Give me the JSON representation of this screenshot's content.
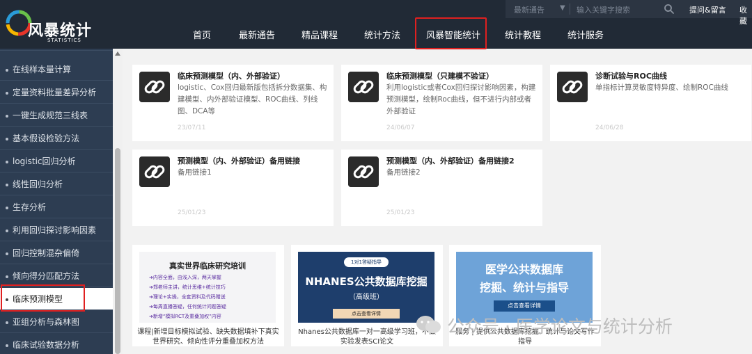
{
  "header": {
    "logo_title": "风暴统计",
    "logo_sub": "STATISTICS",
    "notice_select": "最新通告",
    "search_placeholder": "输入关键字搜索",
    "links": [
      "提问&留言",
      "收藏"
    ],
    "nav": [
      "首页",
      "最新通告",
      "精品课程",
      "统计方法",
      "风暴智能统计",
      "统计教程",
      "统计服务"
    ]
  },
  "sidebar": {
    "items": [
      "在线样本量计算",
      "定量资料批量差异分析",
      "一键生成规范三线表",
      "基本假设检验方法",
      "logistic回归分析",
      "线性回归分析",
      "生存分析",
      "利用回归探讨影响因素",
      "回归控制混杂偏倚",
      "倾向得分匹配方法",
      "临床预测模型",
      "亚组分析与森林图",
      "临床试验数据分析"
    ],
    "active": "临床预测模型"
  },
  "cards": [
    {
      "title": "临床预测模型（内、外部验证）",
      "desc": "logistic、Cox回归最新版包括拆分数据集、构建模型、内外部验证模型、ROC曲线、列线图、DCA等",
      "date": "23/07/11"
    },
    {
      "title": "临床预测模型（只建模不验证）",
      "desc": "利用logistic或者Cox回归探讨影响因素，构建预测模型，绘制Roc曲线，但不进行内部或者外部验证",
      "date": "24/06/07"
    },
    {
      "title": "诊断试验与ROC曲线",
      "desc": "单指标计算灵敏度特异度、绘制ROC曲线",
      "date": "24/06/28"
    },
    {
      "title": "预测模型（内、外部验证）备用链接",
      "desc": "备用链接1",
      "date": "25/01/23"
    },
    {
      "title": "预测模型（内、外部验证）备用链接2",
      "desc": "备用链接2",
      "date": "25/01/23"
    }
  ],
  "promos": [
    {
      "heading": "真实世界临床研究培训",
      "bullets": [
        "➜内容全面，由浅入深，两天掌握",
        "➜郑老师主讲，统计思维+统计技巧",
        "➜理论+实操，全套资料及代码赠送",
        "➜每周直播答疑，任何统计问题答疑",
        "➜新增“模拟RCT及重叠加权”内容"
      ],
      "caption": "课程|新增目标模拟试验、缺失数据填补下真实世界研究、倾向性评分重叠加权方法"
    },
    {
      "badge": "1对1答疑指导",
      "heading": "NHANES公共数据库挖掘",
      "sub": "（高级班）",
      "button": "点击查看详情",
      "caption": "Nhanes公共数据库一对一高级学习班，不做实验发表SCI论文"
    },
    {
      "heading1": "医学公共数据库",
      "heading2": "挖掘、统计与指导",
      "button": "点击查看详情",
      "caption": "服务 | 提供公共数据库挖掘、统计与论文写作指导"
    }
  ],
  "watermark": "公众号 · 医学论文与统计分析",
  "colors": {
    "header_bg": "#212a36",
    "sidebar_bg": "#2d3d52",
    "highlight_red": "#e02020",
    "promo_blue": "#2a5a8c"
  }
}
